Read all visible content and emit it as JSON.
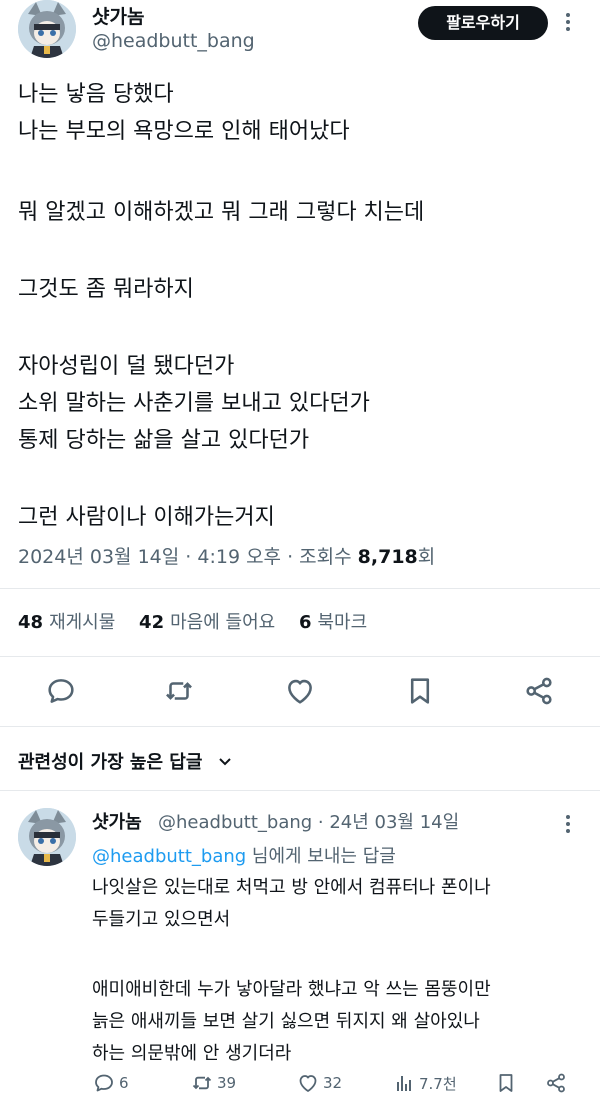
{
  "tweet": {
    "author_name": "샷가놈",
    "author_handle": "@headbutt_bang",
    "follow_label": "팔로우하기",
    "lines": [
      "나는 낳음 당했다",
      "나는 부모의 욕망으로 인해 태어났다",
      "",
      "뭐 알겠고 이해하겠고 뭐 그래 그렇다 치는데",
      "",
      "그것도 좀 뭐라하지",
      "",
      "자아성립이 덜 됐다던가",
      "소위 말하는 사춘기를 보내고 있다던가",
      "통제 당하는 삶을 살고 있다던가",
      "",
      "그런 사람이나 이해가는거지"
    ],
    "date": "2024년 03월 14일",
    "time": "4:19 오후",
    "separator": " · ",
    "views_label": "조회수",
    "views_count": "8,718",
    "views_suffix": "회",
    "retweets_count": "48",
    "retweets_label": "재게시물",
    "likes_count": "42",
    "likes_label": "마음에 들어요",
    "bookmarks_count": "6",
    "bookmarks_label": "북마크"
  },
  "sort": {
    "label": "관련성이 가장 높은 답글"
  },
  "reply": {
    "author_name": "샷가놈",
    "author_handle": "@headbutt_bang · 24년 03월 14일",
    "reply_to_mention": "@headbutt_bang",
    "reply_to_suffix": " 님에게 보내는 답글",
    "lines": [
      "나잇살은 있는대로 처먹고 방 안에서 컴퓨터나 폰이나",
      "두들기고 있으면서",
      "",
      "애미애비한데 누가 낳아달라 했냐고 악 쓰는 몸뚱이만",
      "늙은 애새끼들 보면 살기 싫으면 뒤지지 왜 살아있나",
      "하는 의문밖에 안 생기더라"
    ],
    "replies": "6",
    "retweets": "39",
    "likes": "32",
    "views": "7.7천"
  },
  "colors": {
    "text": "#0f1419",
    "secondary": "#536471",
    "link": "#1d9bf0",
    "button_bg": "#0f1419",
    "divider": "#e6e9ec"
  },
  "icons": {
    "reply": "speech-bubble-icon",
    "retweet": "repost-arrows-icon",
    "like": "heart-icon",
    "bookmark": "bookmark-icon",
    "share": "share-nodes-icon",
    "views": "bar-chart-icon",
    "more": "vertical-dots-icon",
    "sort": "chevron-down-icon"
  }
}
